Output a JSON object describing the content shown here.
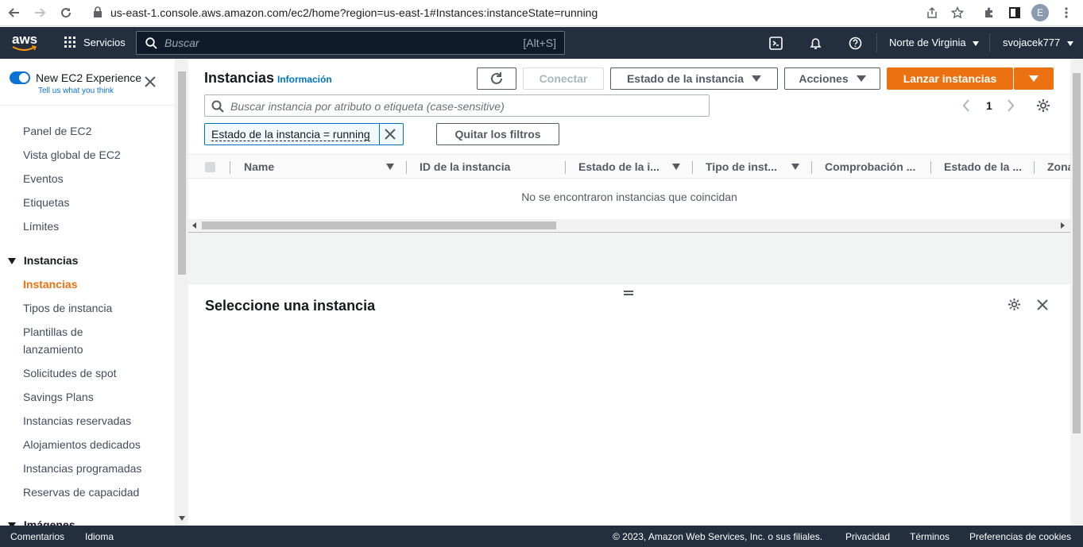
{
  "browser": {
    "url": "us-east-1.console.aws.amazon.com/ec2/home?region=us-east-1#Instances:instanceState=running",
    "avatar_letter": "E"
  },
  "topnav": {
    "logo_text": "aws",
    "services_label": "Servicios",
    "search_placeholder": "Buscar",
    "search_shortcut": "[Alt+S]",
    "region_label": "Norte de Virginia",
    "account_label": "svojacek777"
  },
  "sidebar": {
    "experience_title": "New EC2 Experience",
    "experience_sub": "Tell us what you think",
    "items_top": [
      "Panel de EC2",
      "Vista global de EC2",
      "Eventos",
      "Etiquetas",
      "Límites"
    ],
    "group_instances": "Instancias",
    "items_instances": [
      "Instancias",
      "Tipos de instancia",
      "Plantillas de",
      "lanzamiento",
      "Solicitudes de spot",
      "Savings Plans",
      "Instancias reservadas",
      "Alojamientos dedicados",
      "Instancias programadas",
      "Reservas de capacidad"
    ],
    "group_images": "Imágenes"
  },
  "main": {
    "title": "Instancias",
    "info_link": "Información",
    "connect_label": "Conectar",
    "state_label": "Estado de la instancia",
    "actions_label": "Acciones",
    "launch_label": "Lanzar instancias",
    "filter_placeholder": "Buscar instancia por atributo o etiqueta (case-sensitive)",
    "page_number": "1",
    "filter_token": "Estado de la instancia = running",
    "clear_filters_label": "Quitar los filtros",
    "columns": [
      "Name",
      "ID de la instancia",
      "Estado de la i...",
      "Tipo de inst...",
      "Comprobación ...",
      "Estado de la ...",
      "Zona"
    ],
    "empty_message": "No se encontraron instancias que coincidan",
    "detail_title": "Seleccione una instancia"
  },
  "footer": {
    "feedback": "Comentarios",
    "language": "Idioma",
    "copyright": "© 2023, Amazon Web Services, Inc. o sus filiales.",
    "privacy": "Privacidad",
    "terms": "Términos",
    "cookies": "Preferencias de cookies"
  },
  "colors": {
    "nav_bg": "#232f3e",
    "accent_orange": "#ec7211",
    "link_blue": "#0073bb",
    "toggle_blue": "#0972d3"
  }
}
